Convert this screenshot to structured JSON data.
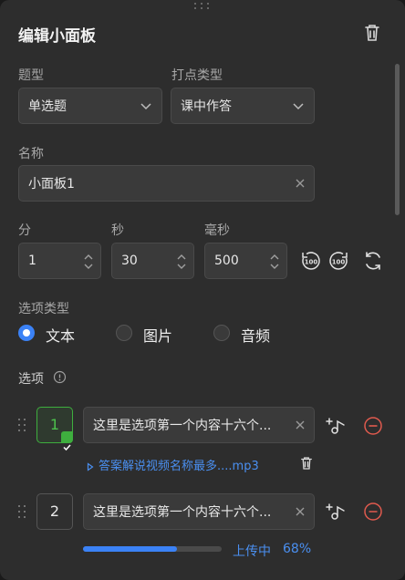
{
  "panel": {
    "title": "编辑小面板",
    "delete_icon": "trash-icon"
  },
  "question_type": {
    "label": "题型",
    "value": "单选题"
  },
  "point_type": {
    "label": "打点类型",
    "value": "课中作答"
  },
  "name": {
    "label": "名称",
    "value": "小面板1"
  },
  "time": {
    "minute": {
      "label": "分",
      "value": "1"
    },
    "second": {
      "label": "秒",
      "value": "30"
    },
    "millisecond": {
      "label": "毫秒",
      "value": "500"
    },
    "rewind_label": "100",
    "forward_label": "100"
  },
  "option_type": {
    "label": "选项类型",
    "options": [
      "文本",
      "图片",
      "音频"
    ],
    "selected": "文本"
  },
  "options_section": {
    "label": "选项"
  },
  "options": [
    {
      "number": "1",
      "text": "这里是选项第一个内容十六个...",
      "correct": true,
      "attachment": "答案解说视频名称最多....mp3"
    },
    {
      "number": "2",
      "text": "这里是选项第一个内容十六个...",
      "correct": false,
      "upload_status": "上传中",
      "upload_percent_text": "68%",
      "upload_progress": 0.68
    }
  ],
  "colors": {
    "accent": "#3b82f6",
    "correct": "#3eae3e",
    "danger": "#e05a4e",
    "link": "#4a8ff0"
  }
}
